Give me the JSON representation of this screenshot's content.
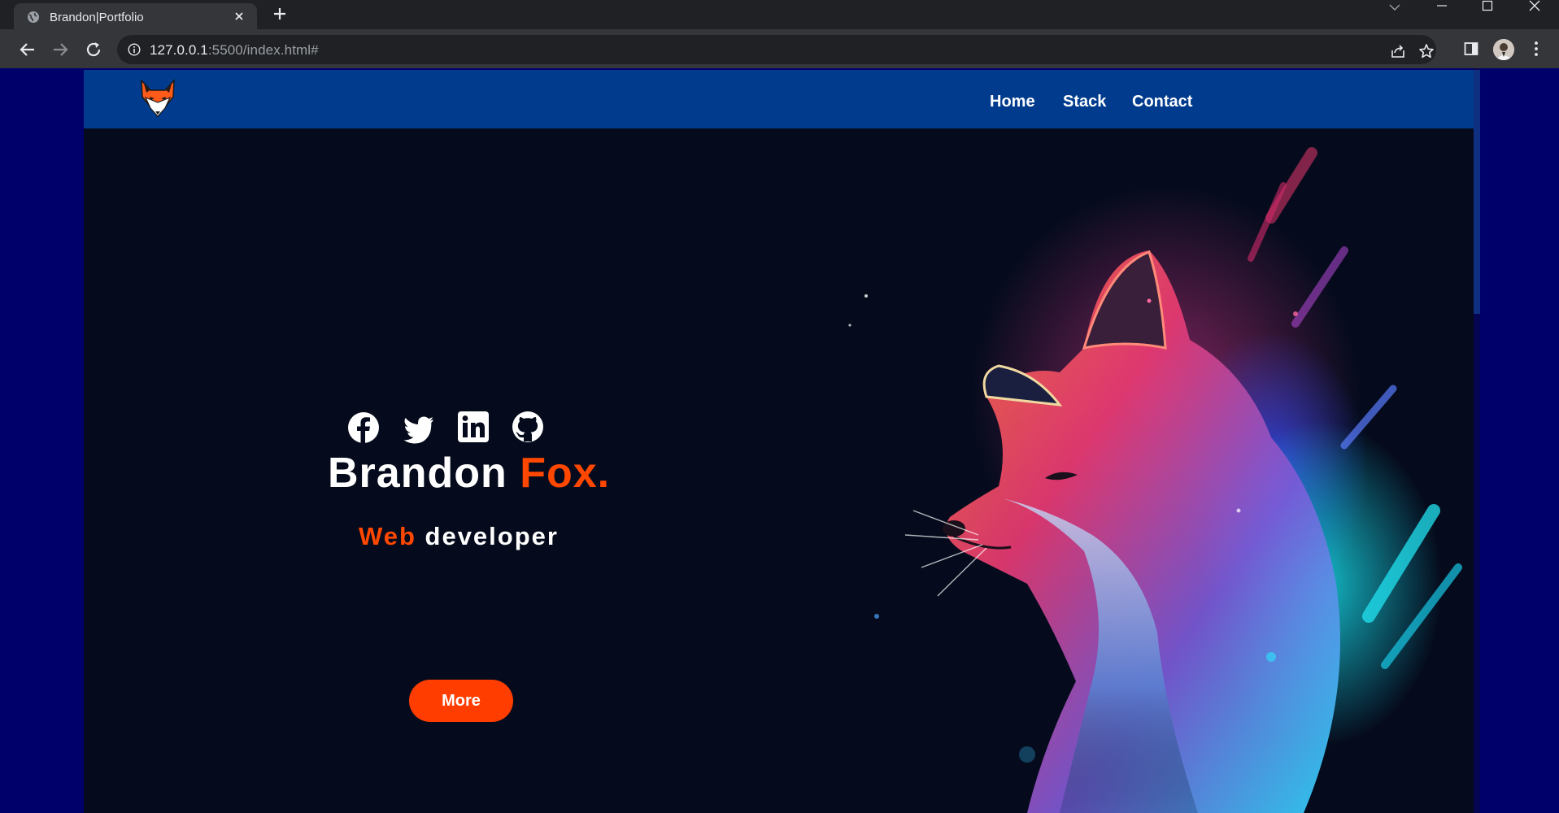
{
  "browser": {
    "tab_title": "Brandon|Portfolio",
    "url_host": "127.0.0.1",
    "url_rest": ":5500/index.html#"
  },
  "site": {
    "nav": {
      "home": "Home",
      "stack": "Stack",
      "contact": "Contact"
    },
    "social": [
      "facebook-icon",
      "twitter-icon",
      "linkedin-icon",
      "github-icon"
    ],
    "hero": {
      "first_name": "Brandon",
      "last_name": "Fox.",
      "role_accent": "Web",
      "role_rest": "developer",
      "button": "More"
    },
    "colors": {
      "accent": "#ff4700",
      "navbar": "#003b8d",
      "page_bg": "#00006b",
      "hero_bg": "#050b1c"
    }
  }
}
